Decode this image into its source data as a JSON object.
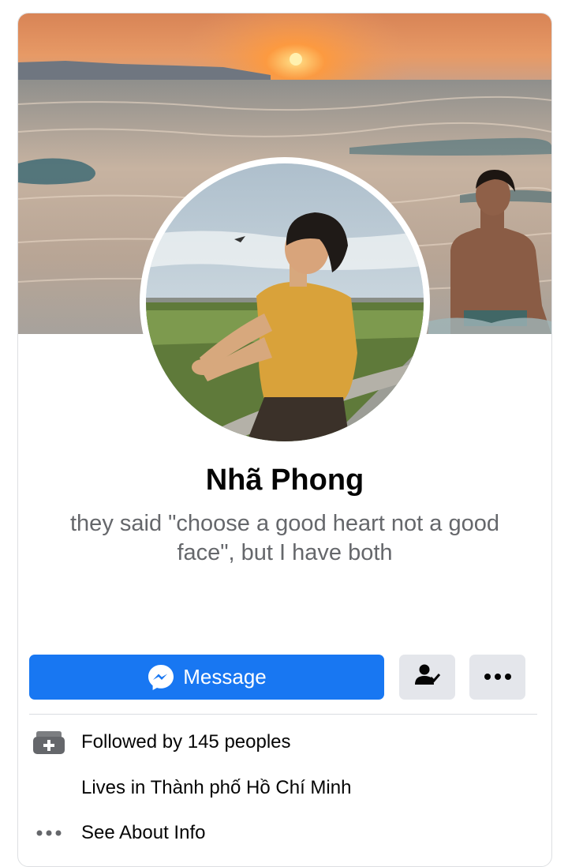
{
  "profile": {
    "name": "Nhã Phong",
    "bio": "they said \"choose a good heart not a good face\", but I have both"
  },
  "actions": {
    "message_label": "Message",
    "message_icon": "messenger-icon",
    "friend_icon": "add-friend-icon",
    "more_icon": "more-horizontal-icon"
  },
  "info": [
    {
      "icon": "followers-icon",
      "text": "Followed by 145 peoples"
    },
    {
      "icon": "",
      "text": "Lives in Thành phố Hồ Chí Minh"
    },
    {
      "icon": "more-horizontal-icon",
      "text": "See About Info"
    }
  ],
  "colors": {
    "primary_button": "#1877f2",
    "secondary_button": "#e4e6eb",
    "name_text": "#050505",
    "bio_text": "#65676b"
  }
}
